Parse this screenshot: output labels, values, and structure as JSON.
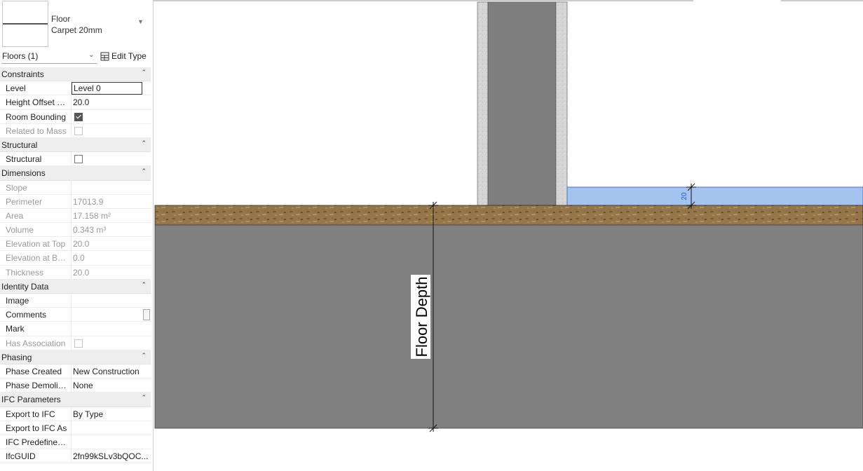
{
  "type_selector": {
    "family": "Floor",
    "type": "Carpet 20mm"
  },
  "filter": {
    "label": "Floors (1)",
    "edit_type": "Edit Type"
  },
  "categories": {
    "constraints": "Constraints",
    "structural": "Structural",
    "dimensions": "Dimensions",
    "identity": "Identity Data",
    "phasing": "Phasing",
    "ifc": "IFC Parameters"
  },
  "props": {
    "level": {
      "name": "Level",
      "value": "Level 0"
    },
    "height_offset": {
      "name": "Height Offset Fr...",
      "value": "20.0"
    },
    "room_bounding": {
      "name": "Room Bounding"
    },
    "related_mass": {
      "name": "Related to Mass"
    },
    "structural": {
      "name": "Structural"
    },
    "slope": {
      "name": "Slope",
      "value": ""
    },
    "perimeter": {
      "name": "Perimeter",
      "value": "17013.9"
    },
    "area": {
      "name": "Area",
      "value": "17.158 m²"
    },
    "volume": {
      "name": "Volume",
      "value": "0.343 m³"
    },
    "elev_top": {
      "name": "Elevation at Top",
      "value": "20.0"
    },
    "elev_bot": {
      "name": "Elevation at Bot...",
      "value": "0.0"
    },
    "thickness": {
      "name": "Thickness",
      "value": "20.0"
    },
    "image": {
      "name": "Image",
      "value": ""
    },
    "comments": {
      "name": "Comments",
      "value": ""
    },
    "mark": {
      "name": "Mark",
      "value": ""
    },
    "has_assoc": {
      "name": "Has Association"
    },
    "phase_created": {
      "name": "Phase Created",
      "value": "New Construction"
    },
    "phase_demolished": {
      "name": "Phase Demolish...",
      "value": "None"
    },
    "export_ifc": {
      "name": "Export to IFC",
      "value": "By Type"
    },
    "export_ifc_as": {
      "name": "Export to IFC As",
      "value": ""
    },
    "ifc_predefined": {
      "name": "IFC Predefined ...",
      "value": ""
    },
    "ifcguid": {
      "name": "IfcGUID",
      "value": "2fn99kSLv3bQOC..."
    }
  },
  "canvas": {
    "dimension_label": "Floor Depth",
    "thickness_dim": "20",
    "colors": {
      "slab": "#808080",
      "carpet": "#a4c3ef",
      "carpet_edge": "#4a74c9",
      "earth": "#95764a",
      "wall_core": "#7e7e7e",
      "wall_finish": "#d4d4d4"
    }
  }
}
